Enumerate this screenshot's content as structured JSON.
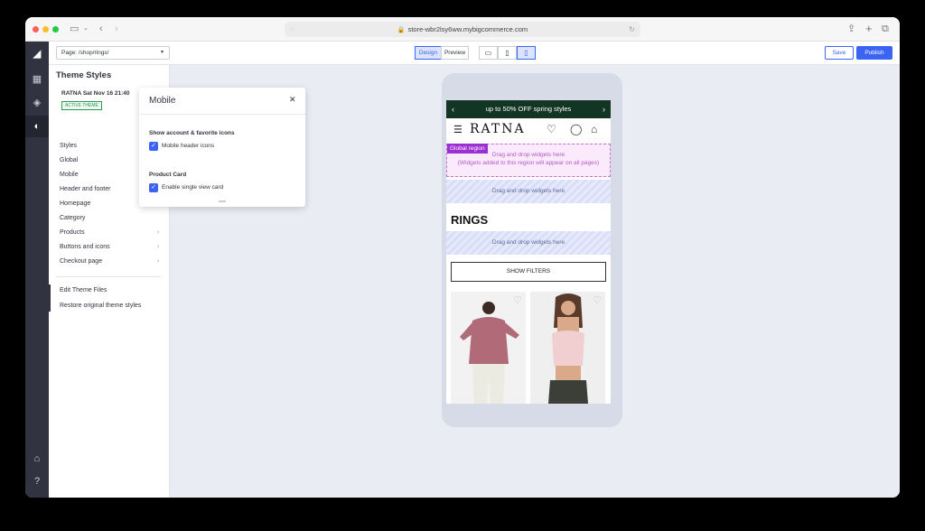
{
  "browser": {
    "url": "store-wbr2lsy6ww.mybigcommerce.com"
  },
  "toolbar": {
    "page_select": "Page: /shop/rings/",
    "design_label": "Design",
    "preview_label": "Preview",
    "save_label": "Save",
    "publish_label": "Publish",
    "active_mode": "Design",
    "active_device": "mobile"
  },
  "sidebar": {
    "title": "Theme Styles",
    "theme_name": "RATNA Sat Nov 16 21:40",
    "theme_badge": "ACTIVE THEME",
    "items": [
      {
        "label": "Styles"
      },
      {
        "label": "Global"
      },
      {
        "label": "Mobile"
      },
      {
        "label": "Header and footer"
      },
      {
        "label": "Homepage"
      },
      {
        "label": "Category"
      },
      {
        "label": "Products"
      },
      {
        "label": "Buttons and icons"
      },
      {
        "label": "Checkout page"
      }
    ],
    "links": [
      {
        "label": "Edit Theme Files"
      },
      {
        "label": "Restore original theme styles"
      }
    ]
  },
  "popup": {
    "title": "Mobile",
    "section1_label": "Show account & favorite icons",
    "checkbox1_label": "Mobile header icons",
    "checkbox1_checked": true,
    "section2_label": "Product Card",
    "checkbox2_label": "Enable single view card",
    "checkbox2_checked": true
  },
  "preview": {
    "promo_text": "up to 50% OFF spring styles",
    "logo_text": "RATNA",
    "global_tag": "Global region",
    "global_line1": "Drag and drop widgets here",
    "global_line2": "(Widgets added to this region will appear on all pages)",
    "dropzone_text": "Drag and drop widgets here",
    "heading": "RINGS",
    "filters_button": "SHOW FILTERS"
  },
  "colors": {
    "accent": "#3c64f4",
    "rail": "#313440",
    "promo_bar": "#123524",
    "global_region_tag": "#9b2fd1",
    "active_badge": "#2c9c55"
  }
}
